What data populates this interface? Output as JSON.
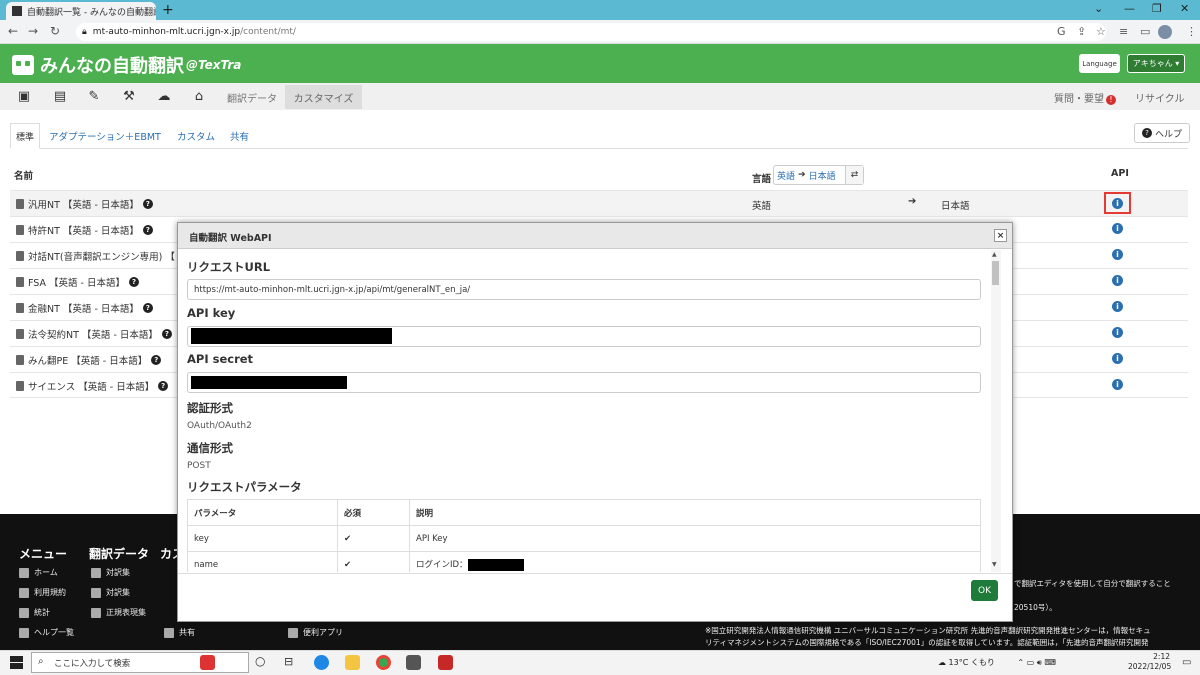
{
  "browser": {
    "tab_title": "自動翻訳一覧 - みんなの自動翻訳",
    "url_host": "mt-auto-minhon-mlt.ucri.jgn-x.jp",
    "url_path": "/content/mt/"
  },
  "header": {
    "logo_text": "みんなの自動翻訳",
    "logo_suffix": "@TexTra",
    "language_button": "Language",
    "user_button": "アキちゃん"
  },
  "nav": {
    "translation_data": "翻訳データ",
    "customize": "カスタマイズ",
    "questions": "質問・要望",
    "recycle": "リサイクル"
  },
  "subtabs": [
    "標準",
    "アダプテーション＋EBMT",
    "カスタム",
    "共有"
  ],
  "help_button": "ヘルプ",
  "table": {
    "col_name": "名前",
    "col_lang": "言語",
    "lang_from": "英語",
    "lang_to": "日本語",
    "col_api": "API",
    "first_row_src": "英語",
    "first_row_tgt": "日本語",
    "rows": [
      "汎用NT 【英語 - 日本語】",
      "特許NT 【英語 - 日本語】",
      "対話NT(音声翻訳エンジン専用) 【",
      "FSA 【英語 - 日本語】",
      "金融NT 【英語 - 日本語】",
      "法令契約NT 【英語 - 日本語】",
      "みん翻PE 【英語 - 日本語】",
      "サイエンス 【英語 - 日本語】"
    ]
  },
  "modal": {
    "title": "自動翻訳 WebAPI",
    "request_url_label": "リクエストURL",
    "request_url": "https://mt-auto-minhon-mlt.ucri.jgn-x.jp/api/mt/generalNT_en_ja/",
    "api_key_label": "API key",
    "api_secret_label": "API secret",
    "auth_label": "認証形式",
    "auth_value": "OAuth/OAuth2",
    "comm_label": "通信形式",
    "comm_value": "POST",
    "params_label": "リクエストパラメータ",
    "params_headers": [
      "パラメータ",
      "必須",
      "説明"
    ],
    "params_rows": [
      {
        "name": "key",
        "required": "✔",
        "desc": "API Key"
      },
      {
        "name": "name",
        "required": "✔",
        "desc": "ログインID："
      }
    ],
    "ok": "OK"
  },
  "footer": {
    "col1_title": "メニュー",
    "col2_title": "翻訳データ",
    "col3_title": "カス",
    "col1": [
      "ホーム",
      "利用規約",
      "統計",
      "ヘルプ一覧"
    ],
    "col2": [
      "対訳集",
      "対訳集",
      "正規表現集"
    ],
    "shared": "共有",
    "useful_apps": "便利アプリ",
    "right_line1": "で翻訳エディタを使用して自分で翻訳すること",
    "right_line2": "20510号）。",
    "right_line3": "※国立研究開発法人情報通信研究機構 ユニバーサルコミュニケーション研究所 先進的音声翻訳研究開発推進センターは，情報セキュ",
    "right_line4": "リティマネジメントシステムの国際規格である「ISO/IEC27001」の認証を取得しています。認証範囲は，「先進的音声翻訳研究開発"
  },
  "taskbar": {
    "search_placeholder": "ここに入力して検索",
    "weather": "13°C くもり",
    "time": "2:12",
    "date": "2022/12/05"
  },
  "colors": {
    "tabstrip": "#5bbad1",
    "header_green": "#4caf50",
    "link_blue": "#2a6fb0",
    "highlight_red": "#e53935",
    "ok_green": "#1e7b3a"
  }
}
